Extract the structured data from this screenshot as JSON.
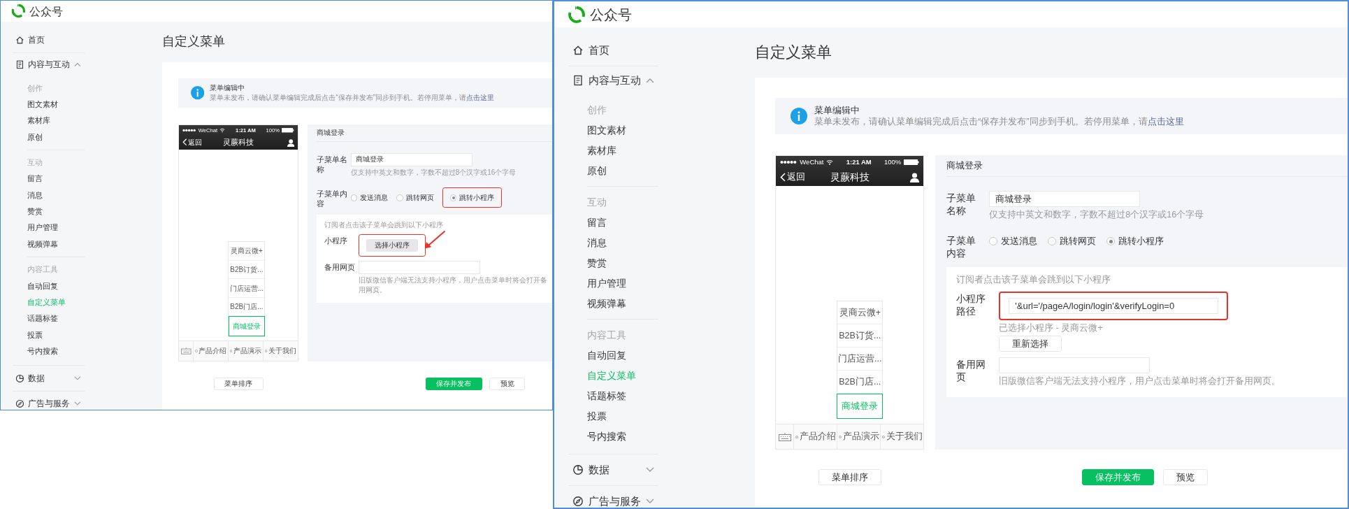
{
  "panels": [
    {
      "brand": "公众号",
      "sidebar": [
        {
          "label": "首页"
        },
        {
          "label": "内容与互动",
          "expanded": true,
          "groups": [
            {
              "title": "创作",
              "items": [
                {
                  "label": "图文素材",
                  "selected": false
                },
                {
                  "label": "素材库",
                  "selected": false
                },
                {
                  "label": "原创",
                  "selected": false
                }
              ]
            },
            {
              "title": "互动",
              "items": [
                {
                  "label": "留言",
                  "selected": false
                },
                {
                  "label": "消息",
                  "selected": false
                },
                {
                  "label": "赞赏",
                  "selected": false
                },
                {
                  "label": "用户管理",
                  "selected": false
                },
                {
                  "label": "视频弹幕",
                  "selected": false
                }
              ]
            },
            {
              "title": "内容工具",
              "items": [
                {
                  "label": "自动回复",
                  "selected": false
                },
                {
                  "label": "自定义菜单",
                  "selected": true
                },
                {
                  "label": "话题标签",
                  "selected": false
                },
                {
                  "label": "投票",
                  "selected": false
                },
                {
                  "label": "号内搜索",
                  "selected": false
                }
              ]
            }
          ]
        },
        {
          "label": "数据",
          "expanded": false
        },
        {
          "label": "广告与服务",
          "expanded": false
        }
      ],
      "page_title": "自定义菜单",
      "notice": {
        "title": "菜单编辑中",
        "text": "菜单未发布，请确认菜单编辑完成后点击“保存并发布”同步到手机。若停用菜单，请",
        "link": "点击这里"
      },
      "phone": {
        "carrier": "WeChat",
        "time": "1:21 AM",
        "battery": "100%",
        "back": "返回",
        "title": "灵蕨科技",
        "menu": [
          {
            "label": "产品介绍"
          },
          {
            "label": "产品演示",
            "sub_items": [
              {
                "label": "灵商云微+",
                "selected": false
              },
              {
                "label": "B2B订货...",
                "selected": false
              },
              {
                "label": "门店运营...",
                "selected": false
              },
              {
                "label": "B2B门店...",
                "selected": false
              },
              {
                "label": "商城登录",
                "selected": true
              }
            ]
          },
          {
            "label": "关于我们"
          }
        ]
      },
      "editor": {
        "title": "商城登录",
        "name_label": "子菜单名称",
        "name_value": "商城登录",
        "name_hint": "仅支持中英文和数字，字数不超过8个汉字或16个字母",
        "content_label": "子菜单内容",
        "content_options": [
          {
            "label": "发送消息",
            "selected": false,
            "highlighted": false
          },
          {
            "label": "跳转网页",
            "selected": false,
            "highlighted": false
          },
          {
            "label": "跳转小程序",
            "selected": true,
            "highlighted": true
          }
        ],
        "target_intro": "订阅者点击该子菜单会跳到以下小程序",
        "target_rows": [
          {
            "kind": "select",
            "label": "小程序",
            "button": "选择小程序",
            "highlighted": true
          },
          {
            "kind": "url",
            "label": "备用网页",
            "hint": "旧版微信客户端无法支持小程序，用户点击菜单时将会打开备用网页。"
          }
        ]
      },
      "annotation_arrow": true,
      "sort_button": "菜单排序",
      "publish_button": "保存并发布",
      "preview_button": "预览"
    },
    {
      "brand": "公众号",
      "sidebar": [
        {
          "label": "首页"
        },
        {
          "label": "内容与互动",
          "expanded": true,
          "groups": [
            {
              "title": "创作",
              "items": [
                {
                  "label": "图文素材",
                  "selected": false
                },
                {
                  "label": "素材库",
                  "selected": false
                },
                {
                  "label": "原创",
                  "selected": false
                }
              ]
            },
            {
              "title": "互动",
              "items": [
                {
                  "label": "留言",
                  "selected": false
                },
                {
                  "label": "消息",
                  "selected": false
                },
                {
                  "label": "赞赏",
                  "selected": false
                },
                {
                  "label": "用户管理",
                  "selected": false
                },
                {
                  "label": "视频弹幕",
                  "selected": false
                }
              ]
            },
            {
              "title": "内容工具",
              "items": [
                {
                  "label": "自动回复",
                  "selected": false
                },
                {
                  "label": "自定义菜单",
                  "selected": true
                },
                {
                  "label": "话题标签",
                  "selected": false
                },
                {
                  "label": "投票",
                  "selected": false
                },
                {
                  "label": "号内搜索",
                  "selected": false
                }
              ]
            }
          ]
        },
        {
          "label": "数据",
          "expanded": false
        },
        {
          "label": "广告与服务",
          "expanded": false
        }
      ],
      "page_title": "自定义菜单",
      "notice": {
        "title": "菜单编辑中",
        "text": "菜单未发布，请确认菜单编辑完成后点击“保存并发布”同步到手机。若停用菜单，请",
        "link": "点击这里"
      },
      "phone": {
        "carrier": "WeChat",
        "time": "1:21 AM",
        "battery": "100%",
        "back": "返回",
        "title": "灵蕨科技",
        "menu": [
          {
            "label": "产品介绍"
          },
          {
            "label": "产品演示",
            "sub_items": [
              {
                "label": "灵商云微+",
                "selected": false
              },
              {
                "label": "B2B订货...",
                "selected": false
              },
              {
                "label": "门店运营...",
                "selected": false
              },
              {
                "label": "B2B门店...",
                "selected": false
              },
              {
                "label": "商城登录",
                "selected": true
              }
            ]
          },
          {
            "label": "关于我们"
          }
        ]
      },
      "editor": {
        "title": "商城登录",
        "name_label": "子菜单名称",
        "name_value": "商城登录",
        "name_hint": "仅支持中英文和数字，字数不超过8个汉字或16个字母",
        "content_label": "子菜单内容",
        "content_options": [
          {
            "label": "发送消息",
            "selected": false,
            "highlighted": false
          },
          {
            "label": "跳转网页",
            "selected": false,
            "highlighted": false
          },
          {
            "label": "跳转小程序",
            "selected": true,
            "highlighted": false
          }
        ],
        "target_intro": "订阅者点击该子菜单会跳到以下小程序",
        "target_rows": [
          {
            "kind": "path",
            "label": "小程序路径",
            "value": "'&url='/pageA/login/login'&verifyLogin=0",
            "highlighted": true,
            "note": "已选择小程序 - 灵商云微+",
            "button": "重新选择"
          },
          {
            "kind": "url",
            "label": "备用网页",
            "hint": "旧版微信客户端无法支持小程序，用户点击菜单时将会打开备用网页。"
          }
        ]
      },
      "sort_button": "菜单排序",
      "publish_button": "保存并发布",
      "preview_button": "预览"
    }
  ]
}
